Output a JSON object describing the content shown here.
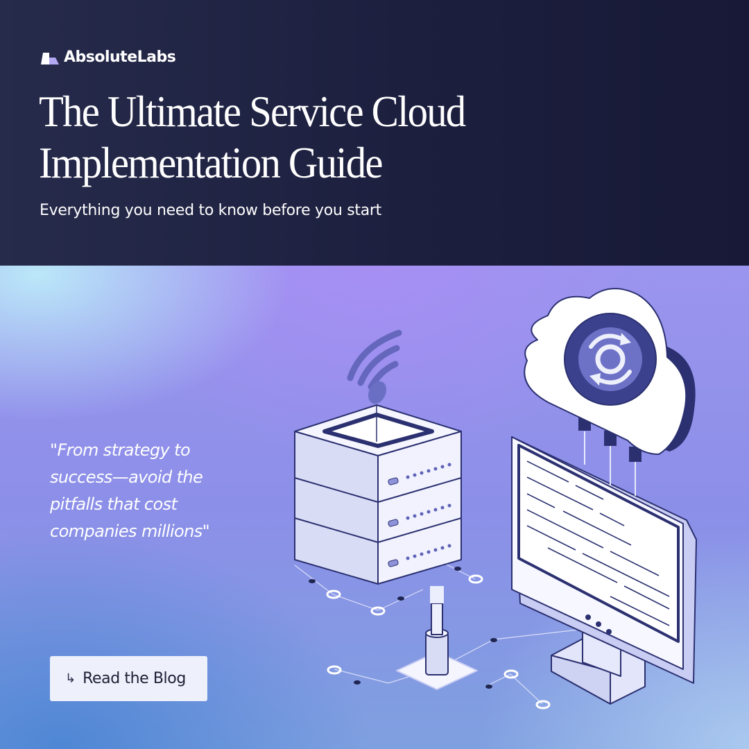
{
  "brand": {
    "name": "AbsoluteLabs"
  },
  "header": {
    "title_line1": "The Ultimate Service Cloud",
    "title_line2": "Implementation Guide",
    "subtitle": "Everything you need to know before you start"
  },
  "quote": {
    "line1": "\"From strategy to",
    "line2": "success—avoid the",
    "line3": "pitfalls that cost",
    "line4": "companies millions\""
  },
  "cta": {
    "icon": "return-arrow-icon",
    "label": "Read the Blog"
  },
  "illustration": {
    "icons": [
      "server-stack-icon",
      "wifi-signal-icon",
      "cloud-sync-icon",
      "monitor-icon",
      "cable-plug-icon"
    ]
  },
  "colors": {
    "header_bg": "#1c1f3e",
    "text_white": "#ffffff",
    "button_bg": "#eef0fb",
    "illustration_navy": "#2b3070",
    "illustration_fill": "#f1f2fd"
  }
}
